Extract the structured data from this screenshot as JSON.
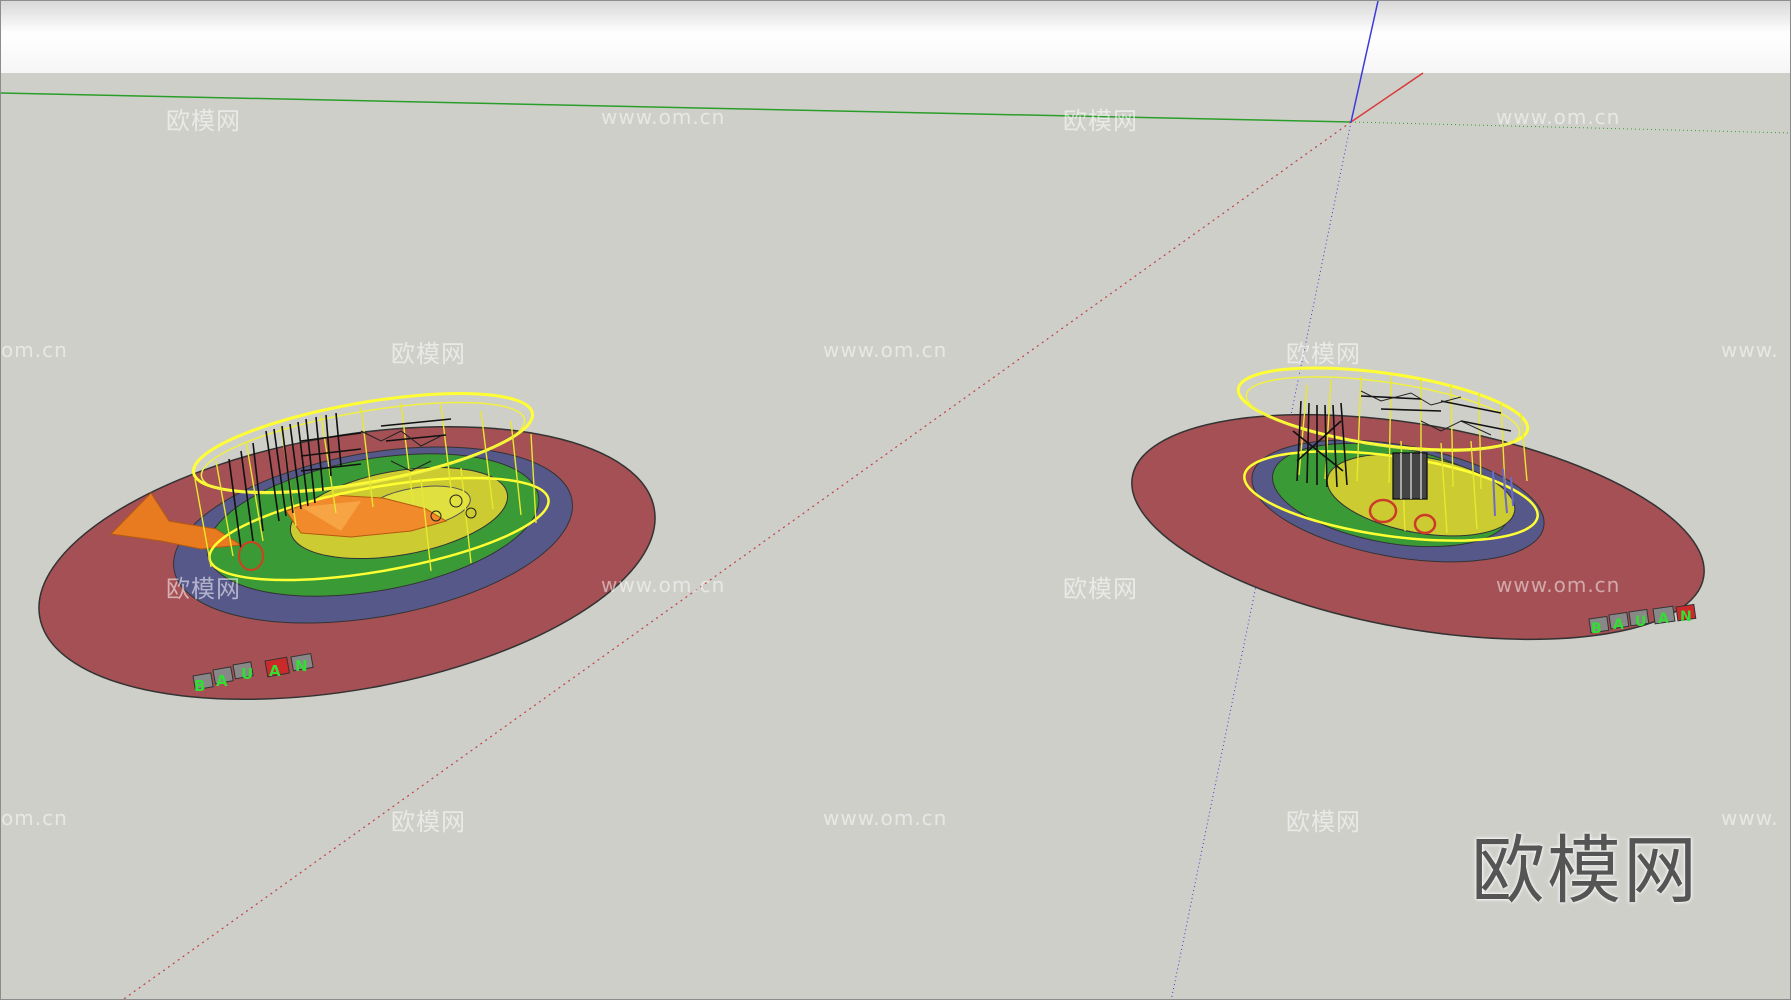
{
  "watermarks": {
    "brand": "欧模网",
    "url": "www.om.cn",
    "url_partial": "om.cn",
    "url_partial_right": "www."
  },
  "corner_logo": "欧模网",
  "sign_letters": [
    "B",
    "A",
    "U",
    "A",
    "N"
  ],
  "colors": {
    "ground": "#cfcfca",
    "outer_ring": "#a45054",
    "middle_ring": "#56588a",
    "green_ring": "#3a9a35",
    "center_disc": "#cccc32",
    "frame": "#ffff33",
    "slide": "#f08a2a",
    "axis_green": "#2a9e2a",
    "axis_red": "#d93a3a",
    "axis_blue": "#3a3ad9"
  }
}
